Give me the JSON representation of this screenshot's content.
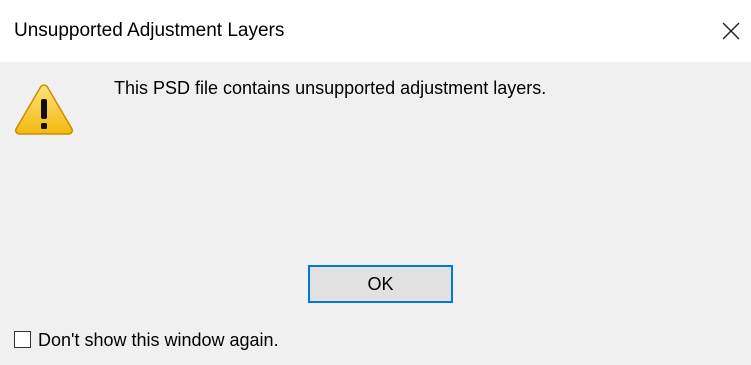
{
  "dialog": {
    "title": "Unsupported Adjustment Layers",
    "message": "This PSD file contains unsupported adjustment layers.",
    "icon": "warning-icon",
    "ok_label": "OK",
    "checkbox": {
      "label": "Don't show this window again.",
      "checked": false
    }
  },
  "colors": {
    "content_background": "#f0f0f0",
    "button_focus_border": "#0078d7",
    "button_background": "#e1e1e1",
    "warning_fill": "#f5c21b"
  }
}
